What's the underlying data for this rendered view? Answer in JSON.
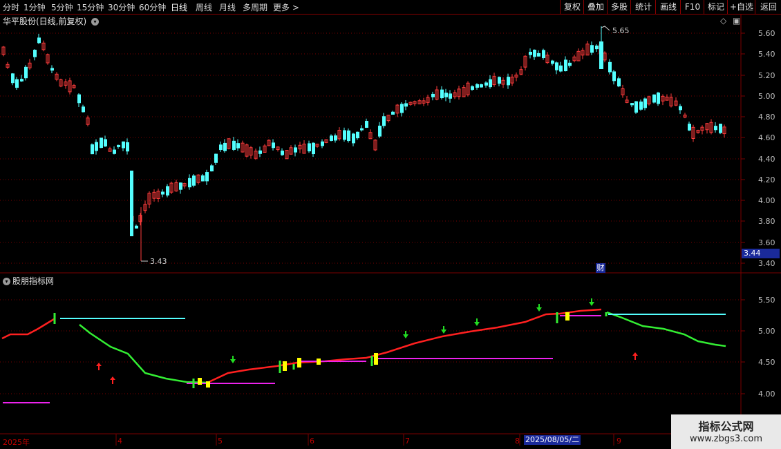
{
  "toolbar": {
    "periods": [
      "分时",
      "1分钟",
      "5分钟",
      "15分钟",
      "30分钟",
      "60分钟",
      "日线",
      "周线",
      "月线",
      "多周期",
      "更多"
    ],
    "active_period": "日线",
    "more_arrow": ">",
    "right_buttons": [
      "复权",
      "叠加",
      "多股",
      "统计",
      "画线",
      "F10",
      "标记",
      "+自选",
      "返回"
    ]
  },
  "main_chart": {
    "title": "华平股份(日线,前复权)",
    "high_label": "5.65",
    "low_label": "3.43",
    "y_axis_labels": [
      "5.60",
      "5.40",
      "5.20",
      "5.00",
      "4.80",
      "4.60",
      "4.40",
      "4.20",
      "4.00",
      "3.80",
      "3.60",
      "3.40"
    ],
    "current_price": "3.44",
    "event_marker": "财"
  },
  "sub_chart": {
    "title": "股朋指标网",
    "y_axis_labels": [
      "5.50",
      "5.00",
      "4.50",
      "4.00"
    ]
  },
  "x_axis": {
    "labels": [
      "2025年",
      "4",
      "5",
      "6",
      "7",
      "8",
      "9"
    ],
    "cursor_date": "2025/08/05/二"
  },
  "watermark": {
    "line1": "指标公式网",
    "line2": "www.zbgs3.com"
  },
  "colors": {
    "up": "#ff3c3c",
    "down": "#54ffff",
    "grid": "#7a0000",
    "line_green": "#33ee33",
    "line_red": "#ff2020",
    "cyan": "#54ffff",
    "magenta": "#ee22ee",
    "yellow": "#ffff00"
  }
}
